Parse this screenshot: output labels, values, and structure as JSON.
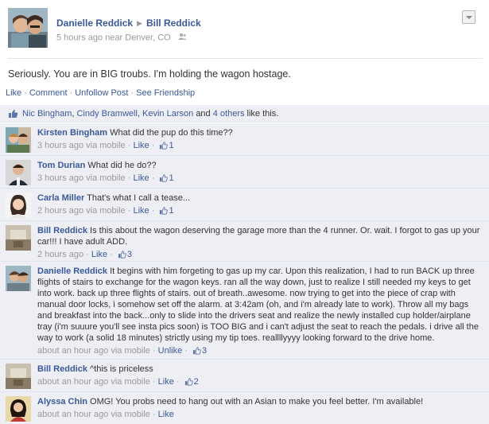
{
  "post": {
    "author": "Danielle Reddick",
    "target": "Bill Reddick",
    "time": "5 hours ago",
    "location": "near Denver, CO",
    "text": "Seriously. You are in BIG troubs. I'm holding the wagon hostage."
  },
  "actions": {
    "like": "Like",
    "comment": "Comment",
    "unfollow": "Unfollow Post",
    "see_friendship": "See Friendship"
  },
  "likes": {
    "name1": "Nic Bingham",
    "name2": "Cindy Bramwell",
    "name3": "Kevin Larson",
    "and": "and",
    "others": "4 others",
    "suffix": "like this."
  },
  "comments": [
    {
      "author": "Kirsten Bingham",
      "text": "What did the pup do this time??",
      "time": "3 hours ago via mobile",
      "like_action": "Like",
      "like_count": "1"
    },
    {
      "author": "Tom Durian",
      "text": "What did he do??",
      "time": "3 hours ago via mobile",
      "like_action": "Like",
      "like_count": "1"
    },
    {
      "author": "Carla Miller",
      "text": "That's what I call a tease...",
      "time": "2 hours ago via mobile",
      "like_action": "Like",
      "like_count": "1"
    },
    {
      "author": "Bill Reddick",
      "text": "Is this about the wagon deserving the garage more than the 4 runner. Or. wait. I forgot to gas up your car!!! I have adult ADD.",
      "time": "2 hours ago",
      "like_action": "Like",
      "like_count": "3"
    },
    {
      "author": "Danielle Reddick",
      "text": "It begins with him forgeting to gas up my car. Upon this realization, I had to run BACK up three flights of stairs to exchange for the wagon keys. ran all the way down, just to realize I still needed my keys to get into work. back up three flights of stairs. out of breath..awesome. now trying to get into the piece of crap with manual door locks, i somehow set off the alarm. at 3:42am (oh, and i'm already late to work). Throw all my bags and breakfast into the back...only to slide into the drivers seat and realize the newly installed cup holder/airplane tray (i'm suuure you'll see insta pics soon) is TOO BIG and i can't adjust the seat to reach the pedals. i drive all the way to work (a solid 18 minutes) strictly using my tip toes. reallllyyyy looking forward to the drive home.",
      "time": "about an hour ago via mobile",
      "like_action": "Unlike",
      "like_count": "3"
    },
    {
      "author": "Bill Reddick",
      "text": "^this is priceless",
      "time": "about an hour ago via mobile",
      "like_action": "Like",
      "like_count": "2"
    },
    {
      "author": "Alyssa Chin",
      "text": "OMG! You probs need to hang out with an Asian to make you feel better. I'm available!",
      "time": "about an hour ago via mobile",
      "like_action": "Like",
      "like_count": ""
    }
  ],
  "icons": {
    "like": "thumbs-up-icon",
    "friends": "friends-icon",
    "dropdown": "chevron-down-icon",
    "separator": "triangle-right-icon"
  },
  "colors": {
    "link": "#3b5998",
    "meta": "#999999",
    "comment_bg": "#edeff4"
  }
}
